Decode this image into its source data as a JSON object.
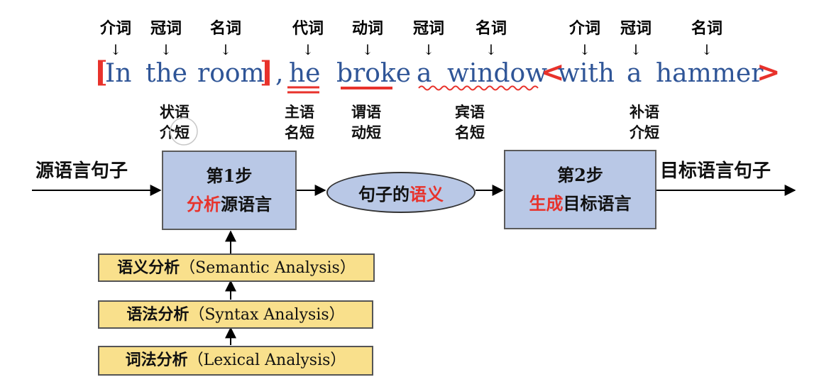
{
  "pos_tags": [
    "介词",
    "冠词",
    "名词",
    "代词",
    "动词",
    "冠词",
    "名词",
    "介词",
    "冠词",
    "名词"
  ],
  "sentence": {
    "open_bracket": "[",
    "w1": "In",
    "w2": "the",
    "w3": "room",
    "close_bracket": "]",
    "comma": ",",
    "w4": "he",
    "w5": "broke",
    "w6": "a",
    "w7": "window",
    "open_angle": "<",
    "w8": "with",
    "w9": "a",
    "w10": "hammer",
    "close_angle": ">"
  },
  "roles": {
    "adverbial": "状语\n介短",
    "subject": "主语\n名短",
    "predicate": "谓语\n动短",
    "object": "宾语\n名短",
    "complement": "补语\n介短"
  },
  "flow": {
    "source_label": "源语言句子",
    "target_label": "目标语言句子",
    "step1_title": "第1步",
    "step1_red": "分析",
    "step1_rest": "源语言",
    "semantics_prefix": "句子的",
    "semantics_red": "语义",
    "step2_title": "第2步",
    "step2_red": "生成",
    "step2_rest": "目标语言"
  },
  "analysis_levels": [
    {
      "cn": "语义分析",
      "en": "（Semantic Analysis）"
    },
    {
      "cn": "语法分析",
      "en": "（Syntax Analysis）"
    },
    {
      "cn": "词法分析",
      "en": "（Lexical Analysis）"
    }
  ],
  "colors": {
    "word_blue": "#2f5597",
    "accent_red": "#e8322b",
    "box_blue": "#b9c8e6",
    "tag_yellow": "#f9e08c"
  }
}
